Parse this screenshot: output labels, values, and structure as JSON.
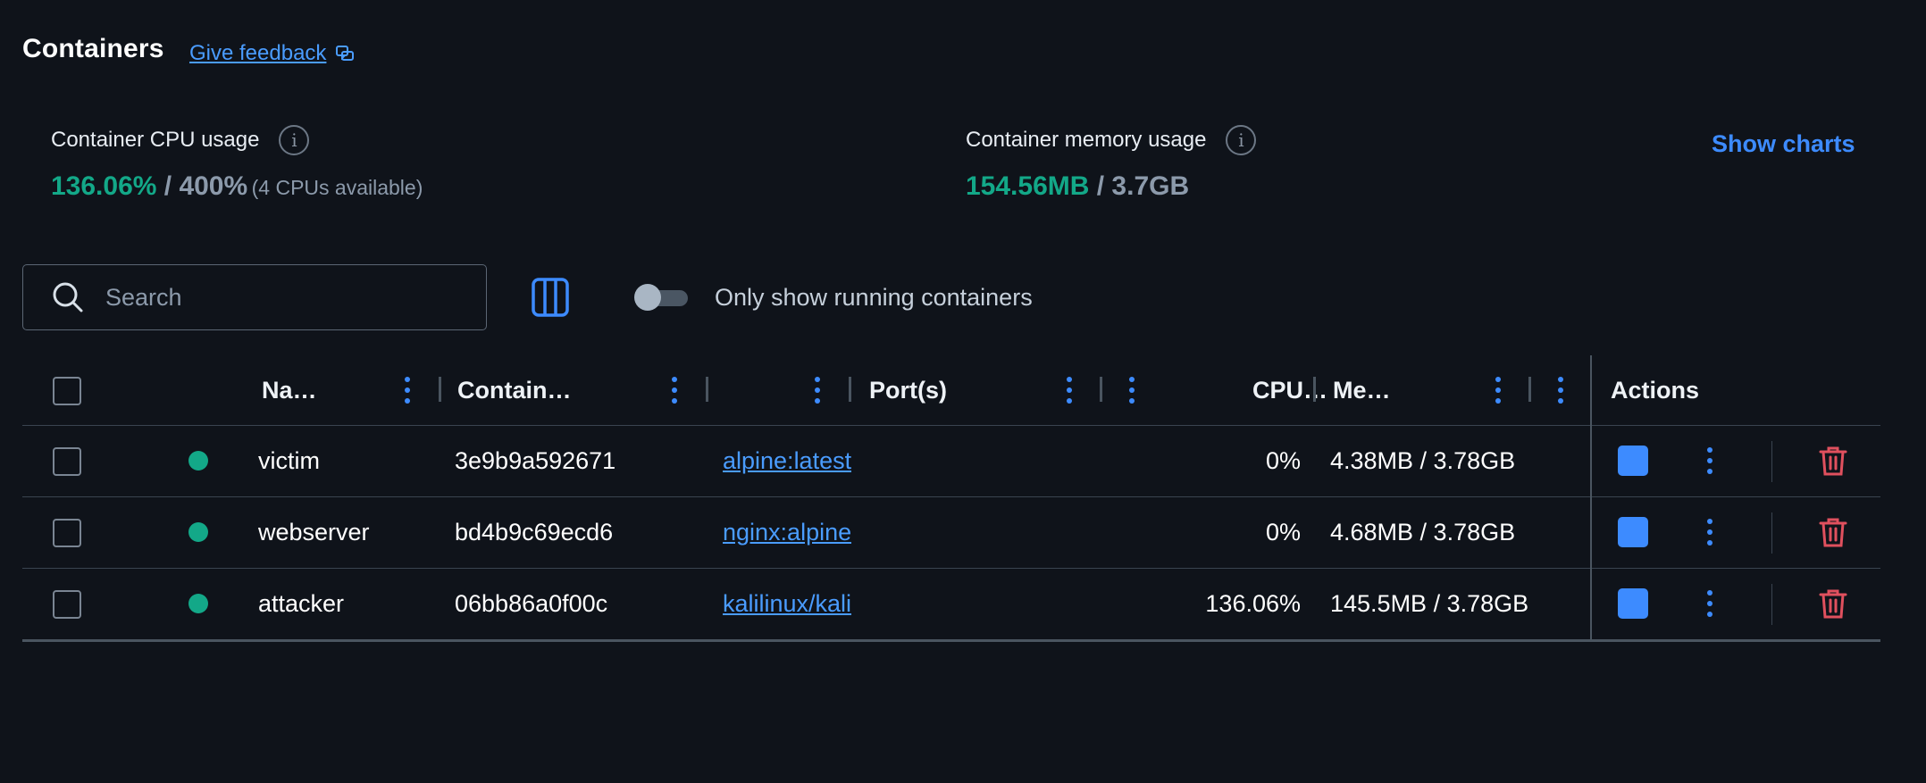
{
  "header": {
    "title": "Containers",
    "feedback_label": "Give feedback"
  },
  "stats": {
    "cpu": {
      "label": "Container CPU usage",
      "used": "136.06%",
      "separator": " / 400%",
      "note": "(4 CPUs available)"
    },
    "memory": {
      "label": "Container memory usage",
      "used": "154.56MB",
      "separator": " / 3.7GB"
    },
    "show_charts_label": "Show charts"
  },
  "toolbar": {
    "search_placeholder": "Search",
    "toggle_label": "Only show running containers",
    "toggle_on": false
  },
  "table": {
    "columns": {
      "name": "Na…",
      "container_id": "Contain…",
      "image": "",
      "ports": "Port(s)",
      "cpu": "CPU…",
      "memory": "Me…",
      "actions": "Actions"
    },
    "rows": [
      {
        "name": "victim",
        "container_id": "3e9b9a592671",
        "image": "alpine:latest",
        "ports": "",
        "cpu": "0%",
        "memory": "4.38MB / 3.78GB",
        "status": "running"
      },
      {
        "name": "webserver",
        "container_id": "bd4b9c69ecd6",
        "image": "nginx:alpine",
        "ports": "",
        "cpu": "0%",
        "memory": "4.68MB / 3.78GB",
        "status": "running"
      },
      {
        "name": "attacker",
        "container_id": "06bb86a0f00c",
        "image": "kalilinux/kali-rolling",
        "ports": "",
        "cpu": "136.06%",
        "memory": "145.5MB / 3.78GB",
        "status": "running"
      }
    ]
  },
  "colors": {
    "accent": "#3d8bff",
    "running": "#13a888",
    "delete": "#e0505e",
    "background": "#0f131a"
  }
}
